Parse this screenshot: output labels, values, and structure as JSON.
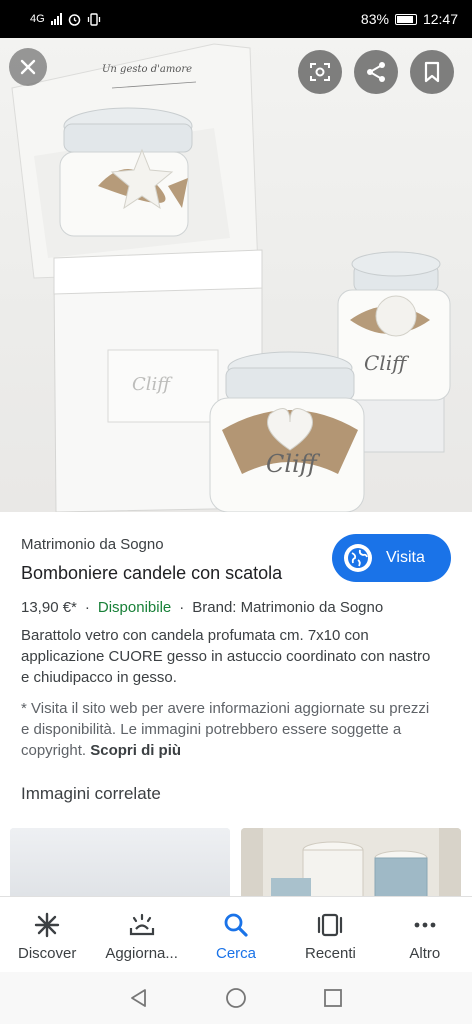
{
  "status_bar": {
    "network": "4G",
    "battery_pct": "83%",
    "time": "12:47"
  },
  "hero": {
    "close_icon": "close-icon",
    "lens_icon": "lens-icon",
    "share_icon": "share-icon",
    "bookmark_icon": "bookmark-icon",
    "box_script": "Un gesto d'amore",
    "brand_mark": "Cliff"
  },
  "product": {
    "site_name": "Matrimonio da Sogno",
    "title": "Bomboniere candele con scatola",
    "visit_label": "Visita",
    "price": "13,90 €*",
    "availability": "Disponibile",
    "brand": "Brand: Matrimonio da Sogno",
    "description": "Barattolo vetro con candela profumata cm. 7x10 con applicazione CUORE gesso in astuccio coordinato con nastro e chiudipacco in gesso.",
    "disclaimer": "* Visita il sito web per avere informazioni aggiornate su prezzi e disponibilità. Le immagini potrebbero essere soggette a copyright.",
    "learn_more": "Scopri di più",
    "related_title": "Immagini correlate"
  },
  "bottom_nav": {
    "items": [
      {
        "label": "Discover",
        "icon": "asterisk-icon"
      },
      {
        "label": "Aggiorna...",
        "icon": "updates-icon"
      },
      {
        "label": "Cerca",
        "icon": "search-icon"
      },
      {
        "label": "Recenti",
        "icon": "recent-tabs-icon"
      },
      {
        "label": "Altro",
        "icon": "more-icon"
      }
    ],
    "active_index": 2
  },
  "colors": {
    "accent": "#1a73e8",
    "available": "#188038"
  }
}
